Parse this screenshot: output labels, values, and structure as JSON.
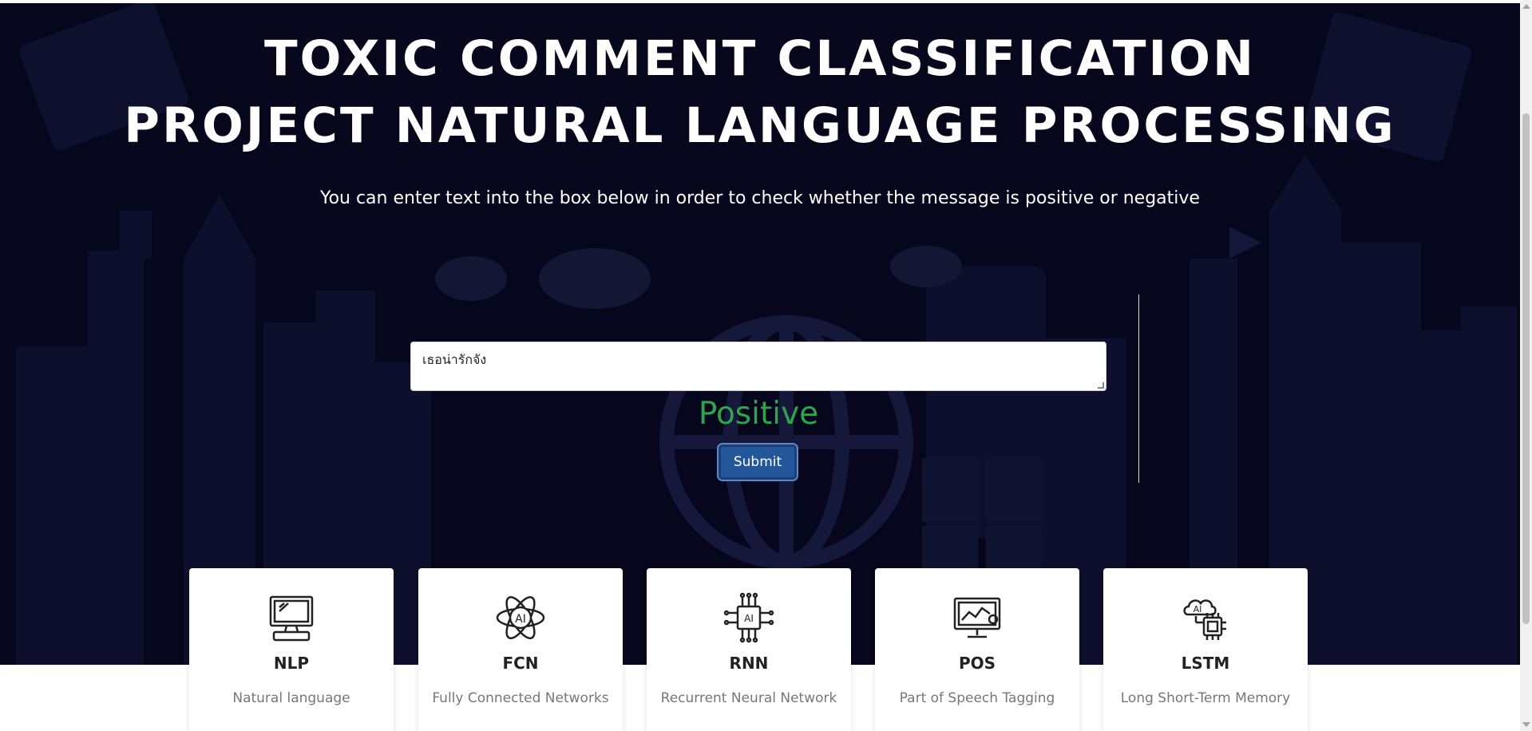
{
  "hero": {
    "title_line1": "TOXIC COMMENT CLASSIFICATION",
    "title_line2": "PROJECT NATURAL LANGUAGE PROCESSING",
    "subtitle": "You can enter text into the box below in order to check whether the message is positive or negative"
  },
  "form": {
    "input_value": "เธอน่ารักจัง",
    "result": "Positive",
    "submit_label": "Submit"
  },
  "cards": [
    {
      "name": "NLP",
      "desc": "Natural language",
      "icon": "computer-icon"
    },
    {
      "name": "FCN",
      "desc": "Fully Connected Networks",
      "icon": "ai-atom-icon"
    },
    {
      "name": "RNN",
      "desc": "Recurrent Neural Network",
      "icon": "ai-chip-icon"
    },
    {
      "name": "POS",
      "desc": "Part of Speech Tagging",
      "icon": "monitor-chart-icon"
    },
    {
      "name": "LSTM",
      "desc": "Long Short-Term Memory",
      "icon": "ai-cloud-chip-icon"
    }
  ],
  "colors": {
    "hero_background": "#06061c",
    "result_text": "#2ea44f",
    "submit_button": "#23579a"
  }
}
